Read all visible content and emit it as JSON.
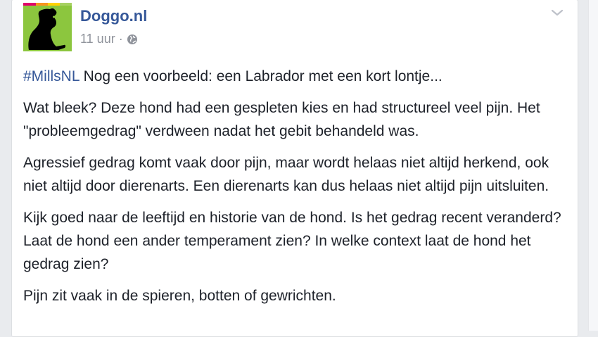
{
  "post": {
    "page_name": "Doggo.nl",
    "timestamp": "11 uur",
    "separator": "·",
    "privacy_icon": "globe-icon",
    "options_icon": "chevron-down-icon",
    "hashtag": "#MillsNL",
    "intro": " Nog een voorbeeld: een Labrador met een kort lontje...",
    "paragraphs": [
      "Wat bleek? Deze hond had een gespleten kies en had structureel veel pijn. Het \"probleemgedrag\" verdween nadat het gebit behandeld was.",
      "Agressief gedrag komt vaak door pijn, maar wordt helaas niet altijd herkend, ook niet altijd door dierenarts. Een dierenarts kan dus helaas niet altijd pijn uitsluiten.",
      "Kijk goed naar de leeftijd en historie van de hond. Is het gedrag recent veranderd? Laat de hond een ander temperament zien? In welke context laat de hond het gedrag zien?",
      "Pijn zit vaak in de spieren, botten of gewrichten."
    ]
  },
  "colors": {
    "link": "#365899",
    "text": "#1d2129",
    "meta": "#90949c",
    "avatar_green": "#8cc63e",
    "page_bg": "#e9ebee",
    "logo_bar": [
      "#e0006c",
      "#f7941d",
      "#ffd200",
      "#8cc63e"
    ]
  }
}
